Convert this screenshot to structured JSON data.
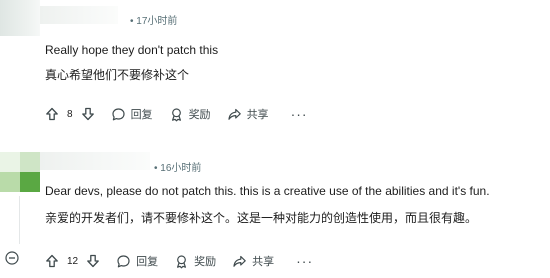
{
  "comments": [
    {
      "time": "• 17小时前",
      "text_en": "Really hope they don't patch this",
      "text_zh": "真心希望他们不要修补这个",
      "votes": "8",
      "reply_label": "回复",
      "award_label": "奖励",
      "share_label": "共享",
      "more_label": "···"
    },
    {
      "time": "• 16小时前",
      "text_en": "Dear devs, please do not patch this. this is a creative use of the abilities and it's fun.",
      "text_zh": "亲爱的开发者们，请不要修补这个。这是一种对能力的创造性使用，而且很有趣。",
      "votes": "12",
      "reply_label": "回复",
      "award_label": "奖励",
      "share_label": "共享",
      "more_label": "···"
    }
  ],
  "icons": {
    "upvote": "arrow-up-icon",
    "downvote": "arrow-down-icon",
    "reply": "speech-bubble-icon",
    "award": "award-ribbon-icon",
    "share": "share-arrow-icon",
    "collapse": "collapse-minus-icon"
  },
  "colors": {
    "meta_text": "#576f76",
    "body_text": "#1c1c1c",
    "avatar_green": "#5aa843"
  }
}
